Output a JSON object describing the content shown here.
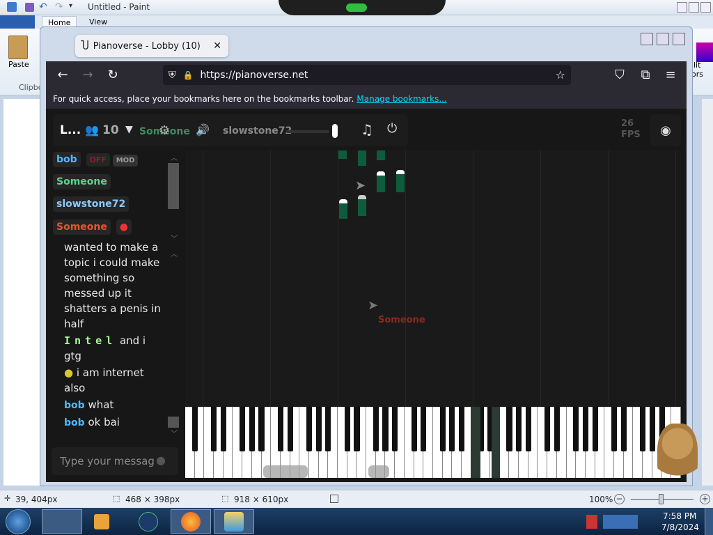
{
  "paint": {
    "title": "Untitled - Paint",
    "tabs": [
      "Home",
      "View"
    ],
    "paste_label": "Paste",
    "clipboard_label": "Clipbo",
    "right_labels": [
      "lit",
      "lors"
    ],
    "status": {
      "cursor_pos": "39, 404px",
      "selection_size": "468 × 398px",
      "image_size": "918 × 610px",
      "zoom": "100%"
    }
  },
  "firefox": {
    "tab_title": "Pianoverse - Lobby (10)",
    "url": "https://pianoverse.net",
    "bookmarks_text": "For quick access, place your bookmarks here on the bookmarks toolbar.",
    "bookmarks_link": "Manage bookmarks..."
  },
  "pianoverse": {
    "room_short": "L...",
    "user_count": "10",
    "toolbar_someone": "Someone",
    "volume_user": "slowstone72",
    "fps_value": "26",
    "fps_label": "FPS",
    "users": [
      {
        "name": "bob",
        "color": "#4fb8ff",
        "badges": [
          "OFF",
          "MOD"
        ]
      },
      {
        "name": "Someone",
        "color": "#57d68d",
        "badges": []
      },
      {
        "name": "slowstone72",
        "color": "#8ec9ff",
        "badges": []
      },
      {
        "name": "Someone",
        "color": "#e8532e",
        "badges": [
          "apple"
        ]
      }
    ],
    "chat": [
      {
        "text": "wanted to make a topic i could make something so messed up it shatters a penis in half"
      },
      {
        "name": "Intel",
        "text": "and i gtg"
      },
      {
        "name": "",
        "text": "i am internet also"
      },
      {
        "name": "bob",
        "text": "what"
      },
      {
        "name": "bob",
        "text": "ok bai"
      }
    ],
    "input_placeholder": "Type your messag",
    "cursor_label": "Someone"
  },
  "taskbar": {
    "time": "7:58 PM",
    "date": "7/8/2024"
  }
}
